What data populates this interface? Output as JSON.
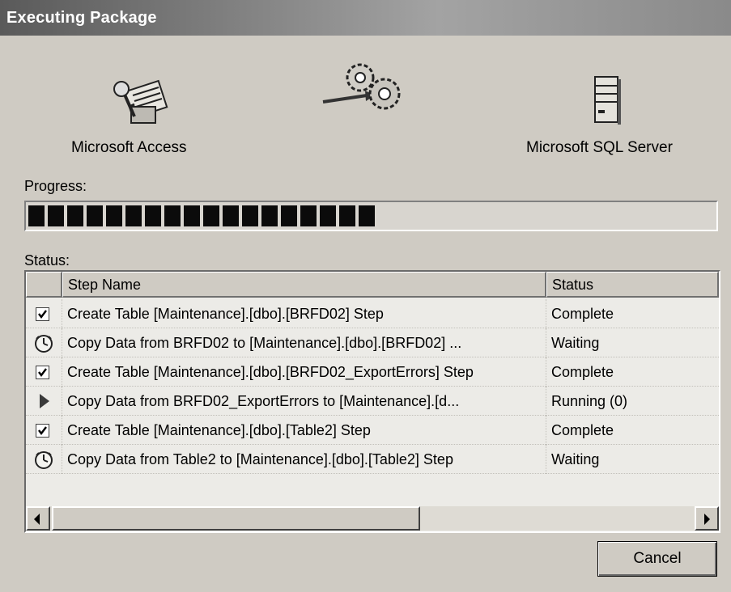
{
  "window": {
    "title": "Executing Package"
  },
  "source": {
    "label": "Microsoft Access",
    "icon": "access-database-icon"
  },
  "transfer": {
    "icon": "gears-transfer-icon"
  },
  "destination": {
    "label": "Microsoft SQL Server",
    "icon": "sql-server-icon"
  },
  "progress": {
    "label": "Progress:",
    "value": 0.5
  },
  "status": {
    "label": "Status:",
    "columns": [
      "Step Name",
      "Status"
    ],
    "rows": [
      {
        "icon": "check-icon",
        "name": "Create Table [Maintenance].[dbo].[BRFD02] Step",
        "status": "Complete"
      },
      {
        "icon": "clock-icon",
        "name": "Copy Data from BRFD02 to [Maintenance].[dbo].[BRFD02] ...",
        "status": "Waiting"
      },
      {
        "icon": "check-icon",
        "name": "Create Table [Maintenance].[dbo].[BRFD02_ExportErrors] Step",
        "status": "Complete"
      },
      {
        "icon": "play-icon",
        "name": "Copy Data from BRFD02_ExportErrors to [Maintenance].[d...",
        "status": "Running (0)"
      },
      {
        "icon": "check-icon",
        "name": "Create Table [Maintenance].[dbo].[Table2] Step",
        "status": "Complete"
      },
      {
        "icon": "clock-icon",
        "name": "Copy Data from Table2 to [Maintenance].[dbo].[Table2] Step",
        "status": "Waiting"
      }
    ]
  },
  "buttons": {
    "cancel": "Cancel"
  }
}
